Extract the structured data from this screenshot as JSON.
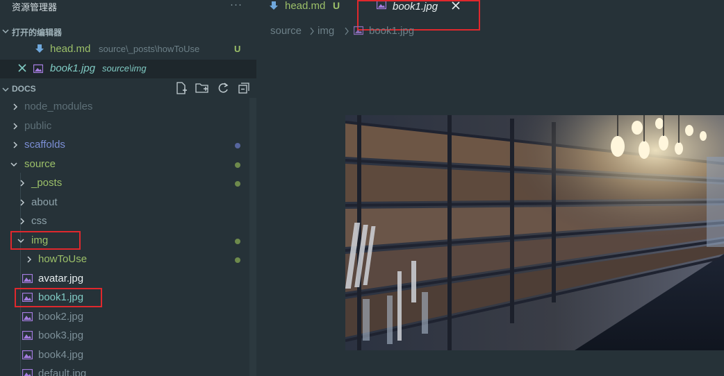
{
  "sidebar": {
    "title": "资源管理器",
    "more_label": "···",
    "open_editors": {
      "label": "打开的编辑器",
      "items": [
        {
          "name": "head.md",
          "path": "source\\_posts\\howToUse",
          "badge": "U"
        },
        {
          "name": "book1.jpg",
          "path": "source\\img"
        }
      ]
    },
    "docs": {
      "label": "DOCS",
      "tree": [
        {
          "label": "node_modules"
        },
        {
          "label": "public"
        },
        {
          "label": "scaffolds"
        },
        {
          "label": "source"
        },
        {
          "label": "_posts"
        },
        {
          "label": "about"
        },
        {
          "label": "css"
        },
        {
          "label": "img"
        },
        {
          "label": "howToUse"
        },
        {
          "label": "avatar.jpg"
        },
        {
          "label": "book1.jpg"
        },
        {
          "label": "book2.jpg"
        },
        {
          "label": "book3.jpg"
        },
        {
          "label": "book4.jpg"
        },
        {
          "label": "default.jpg"
        }
      ]
    }
  },
  "editor": {
    "tabs": [
      {
        "label": "head.md",
        "badge": "U"
      },
      {
        "label": "book1.jpg"
      }
    ],
    "breadcrumb": [
      "source",
      "img",
      "book1.jpg"
    ]
  },
  "colors": {
    "background": "#263238",
    "accent": "#80cbc4",
    "untracked_green": "#9cc069",
    "folder_blue": "#7c8fd6",
    "image_icon": "#a57ce0",
    "highlight_box": "#e0282d"
  }
}
